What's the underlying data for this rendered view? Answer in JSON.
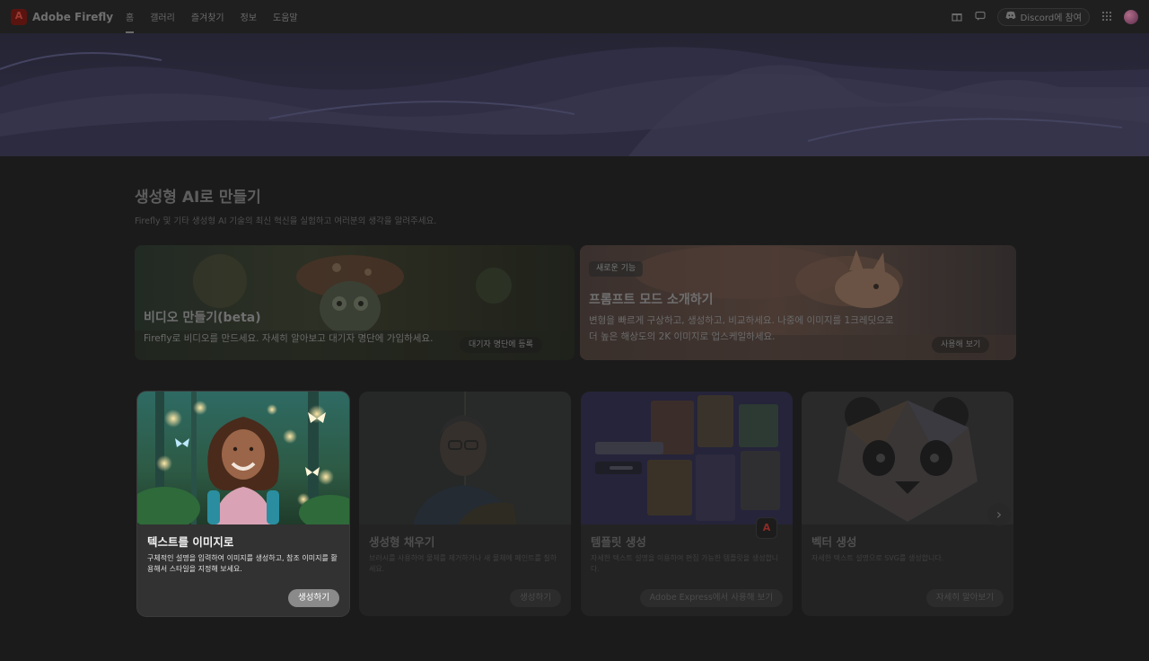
{
  "header": {
    "brand": "Adobe Firefly",
    "nav": [
      {
        "label": "홈"
      },
      {
        "label": "갤러리"
      },
      {
        "label": "즐겨찾기"
      },
      {
        "label": "정보"
      },
      {
        "label": "도움말"
      }
    ],
    "discord_label": "Discord에 참여"
  },
  "section": {
    "title": "생성형 AI로 만들기",
    "subtitle": "Firefly 및 기타 생성형 AI 기술의 최신 혁신을 실험하고 여러분의 생각을 알려주세요."
  },
  "promos": {
    "video": {
      "title": "비디오 만들기(beta)",
      "desc": "Firefly로 비디오를 만드세요. 자세히 알아보고 대기자 명단에 가입하세요.",
      "button": "대기자 명단에 등록"
    },
    "prompt": {
      "badge": "새로운 기능",
      "title": "프롬프트 모드 소개하기",
      "desc_line1": "변형을 빠르게 구상하고, 생성하고, 비교하세요. 나중에 이미지를 1크레딧으로",
      "desc_line2": "더 높은 해상도의 2K 이미지로 업스케일하세요.",
      "button": "사용해 보기"
    }
  },
  "cards": [
    {
      "title": "텍스트를 이미지로",
      "desc": "구체적인 설명을 입력하여 이미지를 생성하고, 참조 이미지를 활용해서 스타일을 지정해 보세요.",
      "button": "생성하기"
    },
    {
      "title": "생성형 채우기",
      "desc": "브러시를 사용하여 물체를 제거하거나 새 물체에 페인트를 칠하세요.",
      "button": "생성하기"
    },
    {
      "title": "템플릿 생성",
      "desc": "자세한 텍스트 설명을 이용하여 편집 가능한 템플릿을 생성합니다.",
      "button": "Adobe Express에서 사용해 보기"
    },
    {
      "title": "벡터 생성",
      "desc": "자세한 텍스트 설명으로 SVG를 생성합니다.",
      "button": "자세히 알아보기"
    }
  ]
}
